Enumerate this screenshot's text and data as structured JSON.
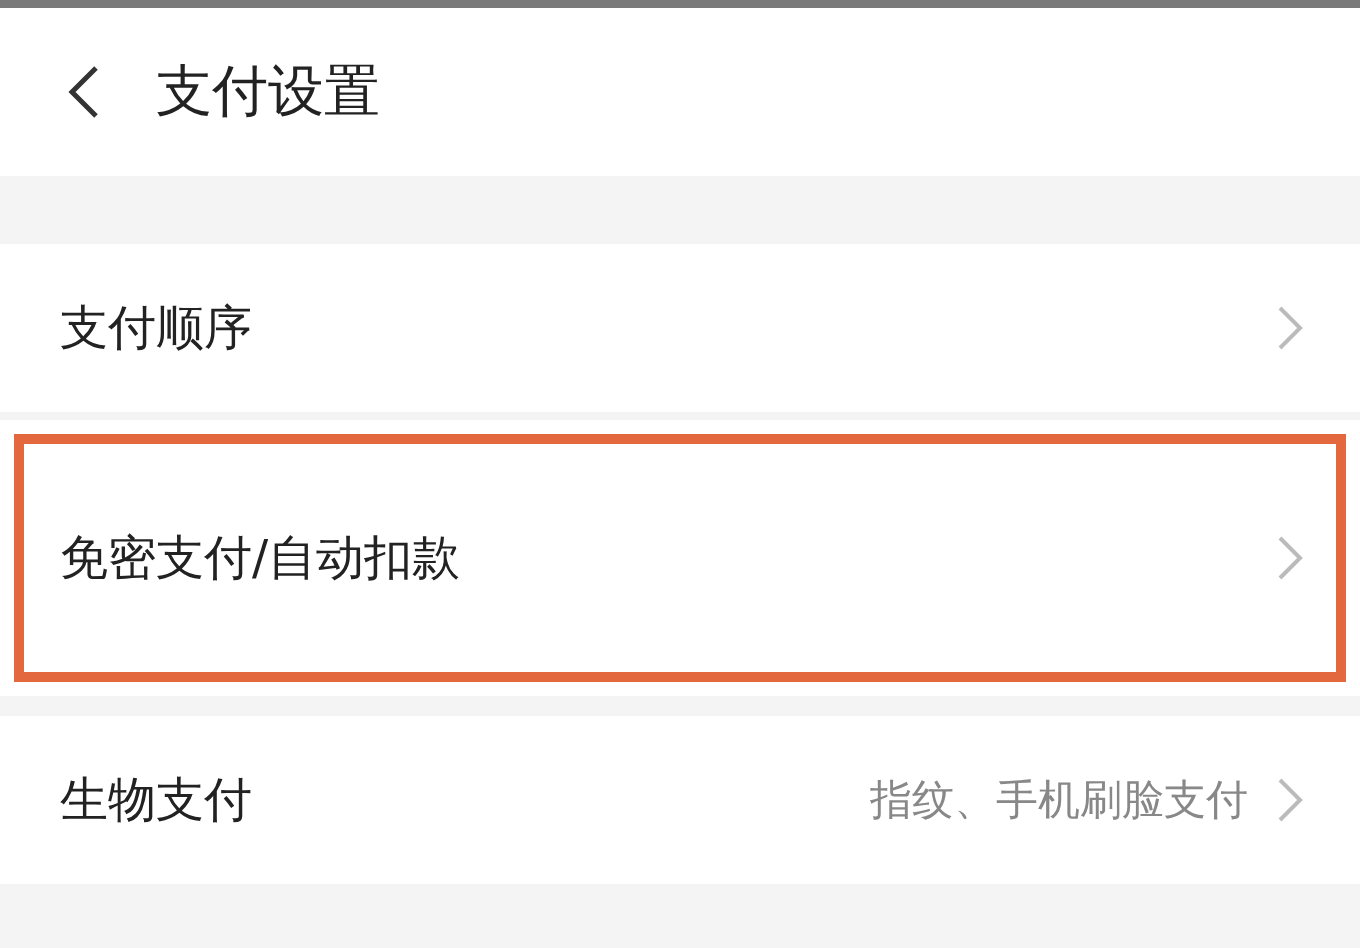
{
  "header": {
    "title": "支付设置"
  },
  "rows": [
    {
      "label": "支付顺序",
      "highlighted": false
    },
    {
      "label": "免密支付/自动扣款",
      "highlighted": true
    },
    {
      "label": "生物支付",
      "value": "指纹、手机刷脸支付",
      "highlighted": false
    }
  ]
}
